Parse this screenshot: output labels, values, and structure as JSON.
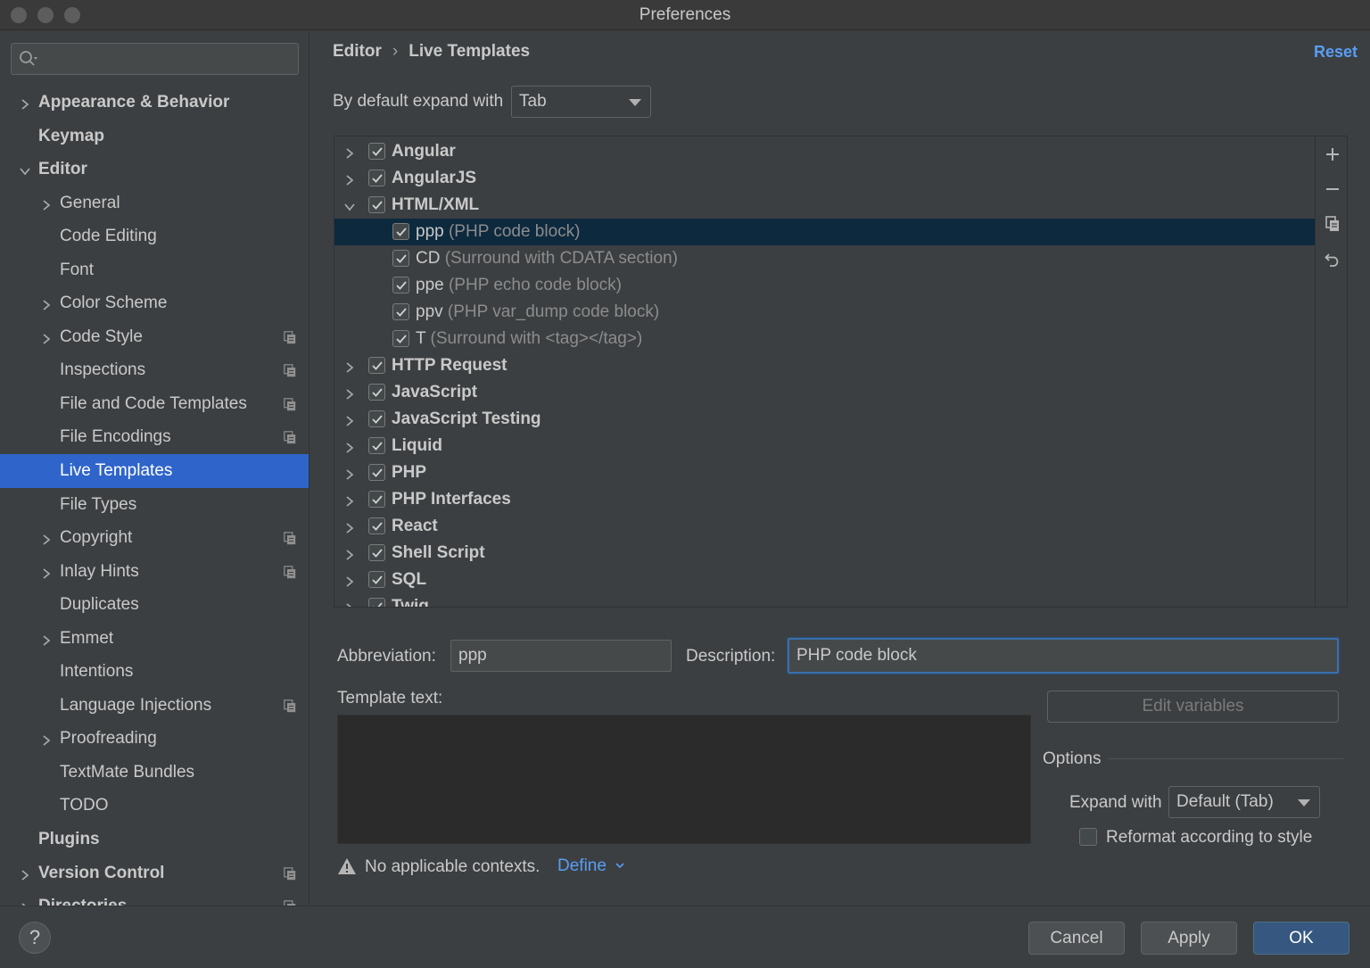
{
  "window": {
    "title": "Preferences"
  },
  "sidebar": {
    "search_placeholder": "",
    "items": [
      {
        "label": "Appearance & Behavior"
      },
      {
        "label": "Keymap"
      },
      {
        "label": "Editor"
      },
      {
        "label": "General"
      },
      {
        "label": "Code Editing"
      },
      {
        "label": "Font"
      },
      {
        "label": "Color Scheme"
      },
      {
        "label": "Code Style"
      },
      {
        "label": "Inspections"
      },
      {
        "label": "File and Code Templates"
      },
      {
        "label": "File Encodings"
      },
      {
        "label": "Live Templates"
      },
      {
        "label": "File Types"
      },
      {
        "label": "Copyright"
      },
      {
        "label": "Inlay Hints"
      },
      {
        "label": "Duplicates"
      },
      {
        "label": "Emmet"
      },
      {
        "label": "Intentions"
      },
      {
        "label": "Language Injections"
      },
      {
        "label": "Proofreading"
      },
      {
        "label": "TextMate Bundles"
      },
      {
        "label": "TODO"
      },
      {
        "label": "Plugins"
      },
      {
        "label": "Version Control"
      },
      {
        "label": "Directories"
      }
    ]
  },
  "header": {
    "breadcrumb_parent": "Editor",
    "breadcrumb_sep": "›",
    "breadcrumb_current": "Live Templates",
    "reset": "Reset"
  },
  "expand": {
    "label": "By default expand with",
    "value": "Tab"
  },
  "tree": {
    "groups": [
      {
        "name": "Angular"
      },
      {
        "name": "AngularJS"
      },
      {
        "name": "HTML/XML"
      },
      {
        "name": "HTTP Request"
      },
      {
        "name": "JavaScript"
      },
      {
        "name": "JavaScript Testing"
      },
      {
        "name": "Liquid"
      },
      {
        "name": "PHP"
      },
      {
        "name": "PHP Interfaces"
      },
      {
        "name": "React"
      },
      {
        "name": "Shell Script"
      },
      {
        "name": "SQL"
      },
      {
        "name": "Twig"
      }
    ],
    "templates": [
      {
        "abbr": "ppp",
        "desc": "(PHP code block)"
      },
      {
        "abbr": "CD",
        "desc": "(Surround with CDATA section)"
      },
      {
        "abbr": "ppe",
        "desc": "(PHP echo code block)"
      },
      {
        "abbr": "ppv",
        "desc": "(PHP var_dump code block)"
      },
      {
        "abbr": "T",
        "desc": "(Surround with <tag></tag>)"
      }
    ]
  },
  "editor": {
    "abbreviation_label": "Abbreviation:",
    "abbreviation_value": "ppp",
    "description_label": "Description:",
    "description_value": "PHP code block",
    "template_text_label": "Template text:",
    "edit_variables": "Edit variables",
    "options_label": "Options",
    "expand_with_label": "Expand with",
    "expand_with_value": "Default (Tab)",
    "reformat_label": "Reformat according to style",
    "reformat_checked": false,
    "contexts_warning": "No applicable contexts.",
    "define_link": "Define"
  },
  "footer": {
    "help": "?",
    "cancel": "Cancel",
    "apply": "Apply",
    "ok": "OK"
  },
  "colors": {
    "accent": "#2f65ca",
    "link": "#589df6",
    "selection_row": "#0d293e",
    "background": "#3c3f41"
  }
}
